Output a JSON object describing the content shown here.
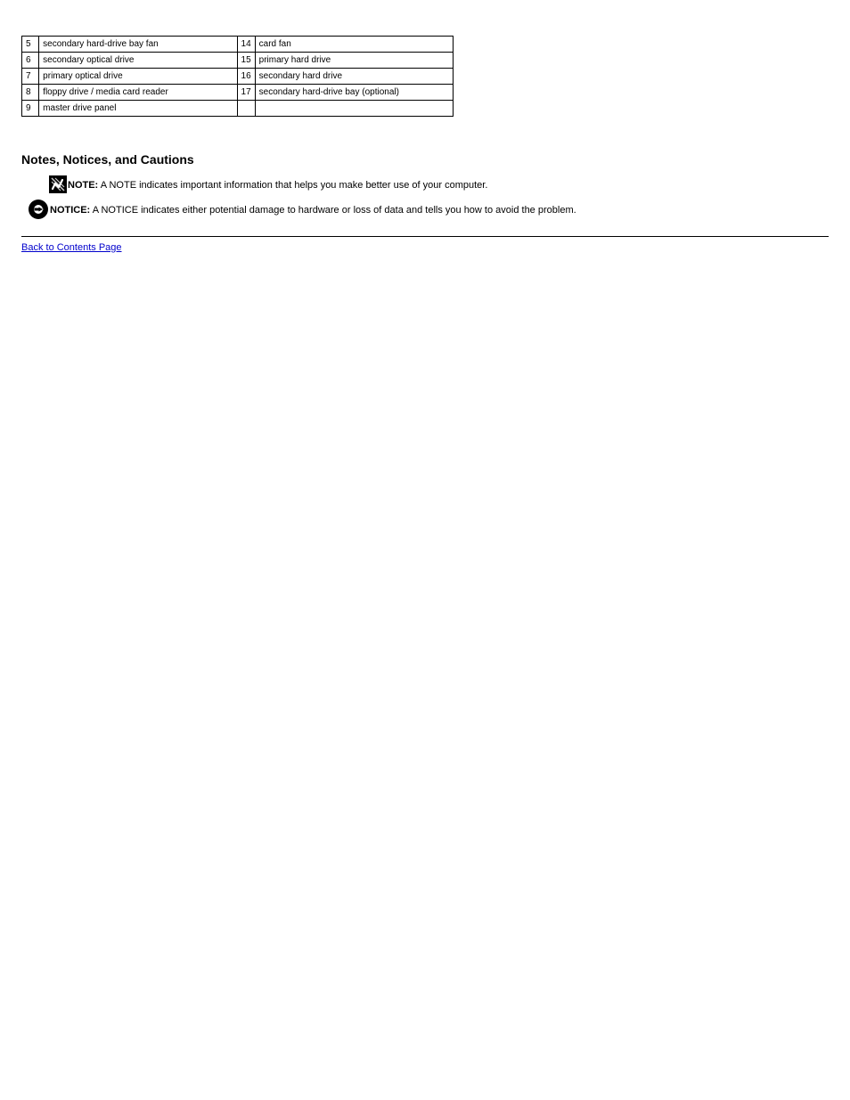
{
  "table": {
    "rows": [
      {
        "left_num": "5",
        "left_desc": "secondary hard-drive bay fan",
        "right_num": "14",
        "right_desc": "card fan"
      },
      {
        "left_num": "6",
        "left_desc": "secondary optical drive",
        "right_num": "15",
        "right_desc": "primary hard drive"
      },
      {
        "left_num": "7",
        "left_desc": "primary optical drive",
        "right_num": "16",
        "right_desc": "secondary hard drive"
      },
      {
        "left_num": "8",
        "left_desc": "floppy drive / media card reader",
        "right_num": "17",
        "right_desc": "secondary hard-drive bay (optional)"
      },
      {
        "left_num": "9",
        "left_desc": "master drive panel",
        "right_num": "",
        "right_desc": ""
      }
    ]
  },
  "notes_heading": "Notes, Notices, and Cautions",
  "note": {
    "lead": "NOTE:",
    "body": "A NOTE indicates important information that helps you make better use of your computer."
  },
  "notice": {
    "lead": "NOTICE:",
    "body": "A NOTICE indicates either potential damage to hardware or loss of data and tells you how to avoid the problem."
  },
  "back_link": "Back to Contents Page"
}
